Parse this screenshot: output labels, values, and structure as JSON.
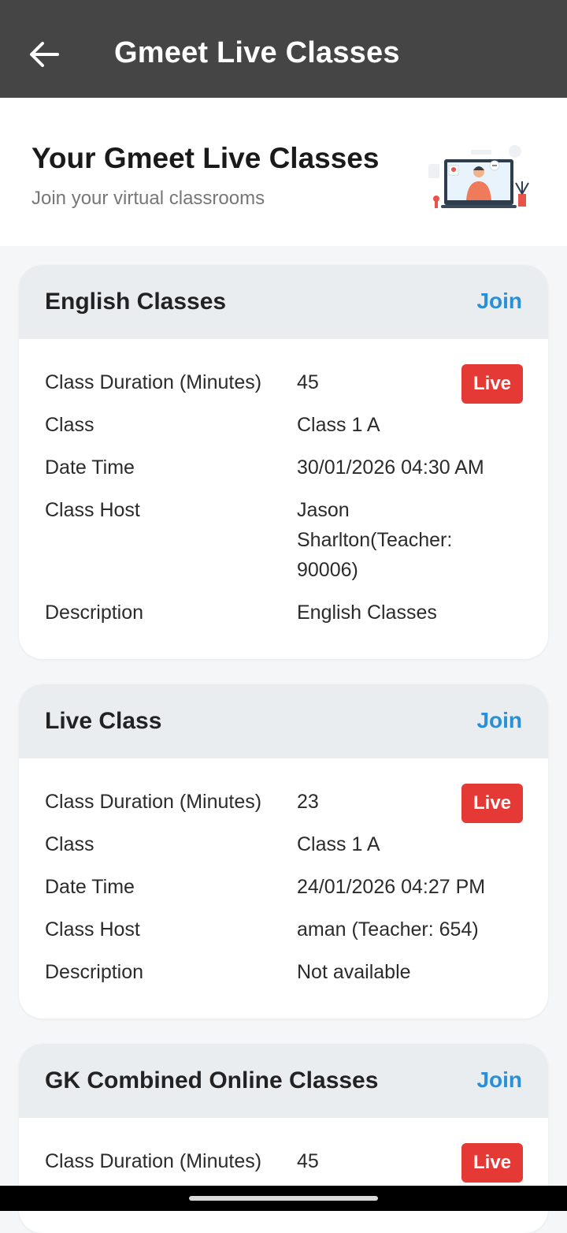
{
  "appbar": {
    "title": "Gmeet Live Classes",
    "back_icon": "arrow-left-icon"
  },
  "hero": {
    "title": "Your Gmeet Live Classes",
    "subtitle": "Join your virtual classrooms",
    "illustration": "teacher-video-call-illustration"
  },
  "labels": {
    "duration": "Class Duration (Minutes)",
    "class": "Class",
    "datetime": "Date Time",
    "host": "Class Host",
    "description": "Description",
    "join": "Join",
    "live": "Live"
  },
  "classes": [
    {
      "title": "English Classes",
      "duration": "45",
      "class": "Class 1 A",
      "datetime": "30/01/2026 04:30 AM",
      "host": "Jason Sharlton(Teacher: 90006)",
      "description": "English Classes"
    },
    {
      "title": "Live Class",
      "duration": "23",
      "class": "Class 1 A",
      "datetime": "24/01/2026 04:27 PM",
      "host": "aman (Teacher: 654)",
      "description": "Not available"
    },
    {
      "title": "GK Combined Online Classes",
      "duration": "45"
    }
  ],
  "colors": {
    "appbar": "#454545",
    "join": "#2a8fd6",
    "live_badge": "#e53935",
    "card_header": "#eaedf0"
  }
}
